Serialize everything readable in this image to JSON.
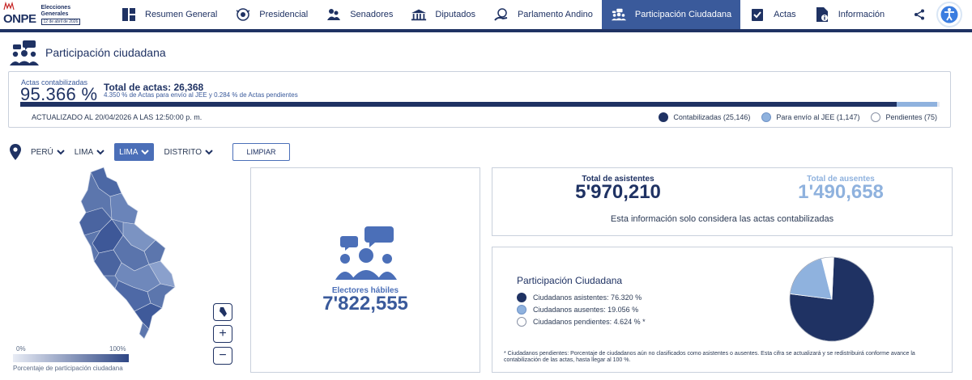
{
  "logo": {
    "brand": "ONPE",
    "line1": "Elecciones",
    "line2": "Generales",
    "date_badge": "12 de abril de 2026"
  },
  "nav": {
    "items": [
      {
        "label": "Resumen General",
        "icon": "grid-icon"
      },
      {
        "label": "Presidencial",
        "icon": "seal-icon"
      },
      {
        "label": "Senadores",
        "icon": "senate-icon"
      },
      {
        "label": "Diputados",
        "icon": "building-icon"
      },
      {
        "label": "Parlamento Andino",
        "icon": "globe-hand-icon"
      },
      {
        "label": "Participación Ciudadana",
        "icon": "people-chat-icon",
        "active": true
      },
      {
        "label": "Actas",
        "icon": "clipboard-check-icon"
      },
      {
        "label": "Información",
        "icon": "document-info-icon"
      }
    ]
  },
  "page": {
    "title": "Participación ciudadana"
  },
  "summary": {
    "label": "Actas contabilizadas",
    "percent": "95.366 %",
    "total_label": "Total de actas: 26,368",
    "sub_label": "4.350 % de Actas para envío al JEE y 0.284 % de Actas pendientes",
    "updated": "ACTUALIZADO AL 20/04/2026 A LAS 12:50:00 p. m.",
    "progress": {
      "contabilizadas_pct": 95.366,
      "jee_pct": 4.35,
      "pendientes_pct": 0.284
    },
    "legend": [
      {
        "label": "Contabilizadas (25,146)",
        "color": "#1f3263"
      },
      {
        "label": "Para envío al JEE (1,147)",
        "color": "#8fb2de"
      },
      {
        "label": "Pendientes (75)",
        "color": "#ffffff"
      }
    ]
  },
  "filters": {
    "items": [
      {
        "label": "PERÚ",
        "active": false
      },
      {
        "label": "LIMA",
        "active": false
      },
      {
        "label": "LIMA",
        "active": true
      },
      {
        "label": "DISTRITO",
        "active": false
      }
    ],
    "clear_label": "LIMPIAR"
  },
  "map": {
    "scale_min": "0%",
    "scale_max": "100%",
    "scale_caption": "Porcentaje de participación ciudadana",
    "controls": [
      "peru-icon",
      "+",
      "−"
    ]
  },
  "electores": {
    "label": "Electores hábiles",
    "value": "7'822,555"
  },
  "asistentes": {
    "label": "Total de asistentes",
    "value": "5'970,210",
    "aus_label": "Total de ausentes",
    "aus_value": "1'490,658",
    "note": "Esta información solo considera las actas contabilizadas"
  },
  "participacion": {
    "title": "Participación Ciudadana",
    "legend": [
      {
        "label": "Ciudadanos asistentes: 76.320 %",
        "color": "#1f3263"
      },
      {
        "label": "Ciudadanos ausentes: 19.056 %",
        "color": "#8fb2de"
      },
      {
        "label": "Ciudadanos pendientes: 4.624 % *",
        "color": "#ffffff"
      }
    ],
    "footnote": "* Ciudadanos pendientes: Porcentaje de ciudadanos aún no clasificados como asistentes o ausentes. Esta cifra se actualizará y se redistribuirá conforme avance la contabilización de las actas, hasta llegar al 100 %."
  },
  "chart_data": {
    "type": "pie",
    "categories": [
      "Ciudadanos asistentes",
      "Ciudadanos ausentes",
      "Ciudadanos pendientes"
    ],
    "values": [
      76.32,
      19.056,
      4.624
    ],
    "colors": [
      "#1f3263",
      "#8fb2de",
      "#ffffff"
    ]
  }
}
